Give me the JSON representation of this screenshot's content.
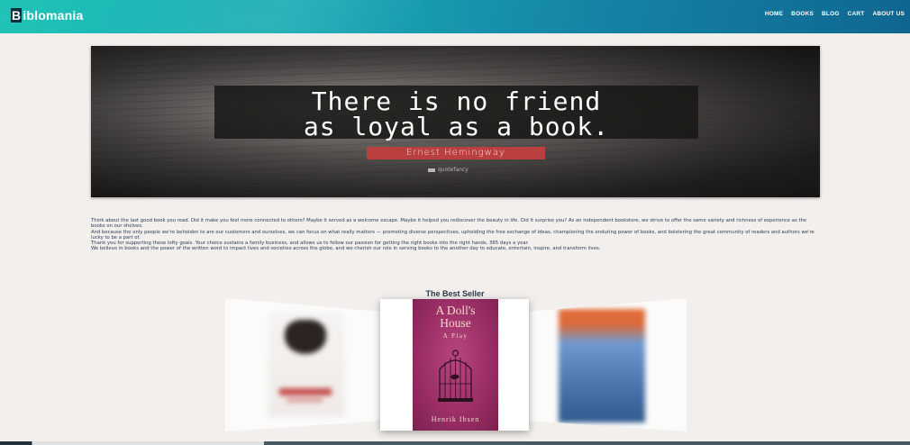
{
  "header": {
    "logo_mark": "B",
    "logo_rest": "iblomania",
    "nav": [
      "HOME",
      "BOOKS",
      "BLOG",
      "CART",
      "ABOUT US"
    ]
  },
  "hero": {
    "quote_line1": "There is no friend",
    "quote_line2": "as loyal as a book.",
    "author": "Ernest Hemingway",
    "watermark": "quotefancy"
  },
  "intro": {
    "paragraphs": [
      "Think about the last good book you read. Did it make you feel more connected to others? Maybe it served as a welcome escape. Maybe it helped you rediscover the beauty in life. Did it surprise you? As an independent bookstore, we strive to offer the same variety and richness of experience as the books on our shelves.",
      "And because the only people we're beholden to are our customers and ourselves, we can focus on what really matters — promoting diverse perspectives, upholding the free exchange of ideas, championing the enduring power of books, and bolstering the great community of readers and authors we're lucky to be a part of.",
      "Thank you for supporting these lofty goals. Your choice sustains a family business, and allows us to follow our passion for getting the right books into the right hands, 365 days a year.",
      "We believe in books and the power of the written word to impact lives and societies across the globe, and we cherish our role in serving books to the another day to educate, entertain, inspire, and transform lives."
    ]
  },
  "best_seller": {
    "title": "The Best Seller",
    "center_book": {
      "title_line1": "A Doll's",
      "title_line2": "House",
      "subtitle": "A Play",
      "author": "Henrik Ibsen"
    }
  },
  "colors": {
    "header_start": "#20c3b7",
    "header_end": "#0f6690",
    "author_bg": "#b9403f",
    "page_bg": "#f2efec",
    "cover": "#9b2f66"
  }
}
